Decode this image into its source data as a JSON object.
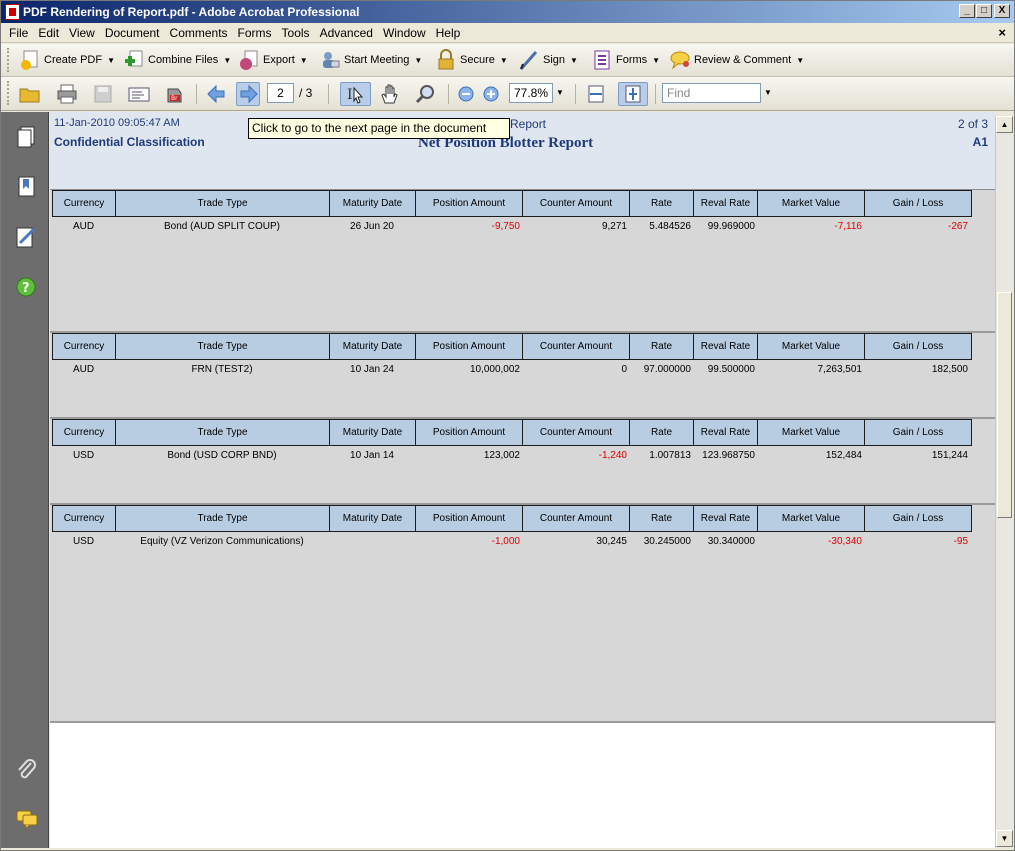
{
  "window": {
    "title": "PDF Rendering of Report.pdf - Adobe Acrobat Professional",
    "minimize": "_",
    "maximize": "□",
    "close": "X"
  },
  "menu": {
    "items": [
      "File",
      "Edit",
      "View",
      "Document",
      "Comments",
      "Forms",
      "Tools",
      "Advanced",
      "Window",
      "Help"
    ],
    "close_doc": "×"
  },
  "toolbar1": {
    "create_pdf": "Create PDF",
    "combine_files": "Combine Files",
    "export": "Export",
    "start_meeting": "Start Meeting",
    "secure": "Secure",
    "sign": "Sign",
    "forms": "Forms",
    "review_comment": "Review & Comment"
  },
  "toolbar2": {
    "page_current": "2",
    "page_total": "/ 3",
    "zoom": "77.8%",
    "find_placeholder": "Find"
  },
  "tooltip": "Click to go to the next page in the document",
  "report": {
    "timestamp": "11-Jan-2010 09:05:47 AM",
    "classification": "Confidential Classification",
    "title_partial": "Report",
    "title": "Net Position Blotter Report",
    "page": "2 of 3",
    "code": "A1"
  },
  "columns": [
    "Currency",
    "Trade Type",
    "Maturity Date",
    "Position Amount",
    "Counter Amount",
    "Rate",
    "Reval Rate",
    "Market Value",
    "Gain / Loss"
  ],
  "rows": [
    {
      "currency": "AUD",
      "trade_type": "Bond (AUD SPLIT COUP)",
      "maturity": "26 Jun 20",
      "position": "-9,750",
      "counter": "9,271",
      "rate": "5.484526",
      "reval": "99.969000",
      "market": "-7,116",
      "gain": "-267"
    },
    {
      "currency": "AUD",
      "trade_type": "FRN (TEST2)",
      "maturity": "10 Jan 24",
      "position": "10,000,002",
      "counter": "0",
      "rate": "97.000000",
      "reval": "99.500000",
      "market": "7,263,501",
      "gain": "182,500"
    },
    {
      "currency": "USD",
      "trade_type": "Bond (USD CORP BND)",
      "maturity": "10 Jan 14",
      "position": "123,002",
      "counter": "-1,240",
      "rate": "1.007813",
      "reval": "123.968750",
      "market": "152,484",
      "gain": "151,244"
    },
    {
      "currency": "USD",
      "trade_type": "Equity (VZ Verizon Communications)",
      "maturity": "",
      "position": "-1,000",
      "counter": "30,245",
      "rate": "30.245000",
      "reval": "30.340000",
      "market": "-30,340",
      "gain": "-95"
    }
  ],
  "colors": {
    "negative": "#e00000",
    "header_bg": "#b9cde2",
    "title_blue": "#1f3a7a"
  }
}
